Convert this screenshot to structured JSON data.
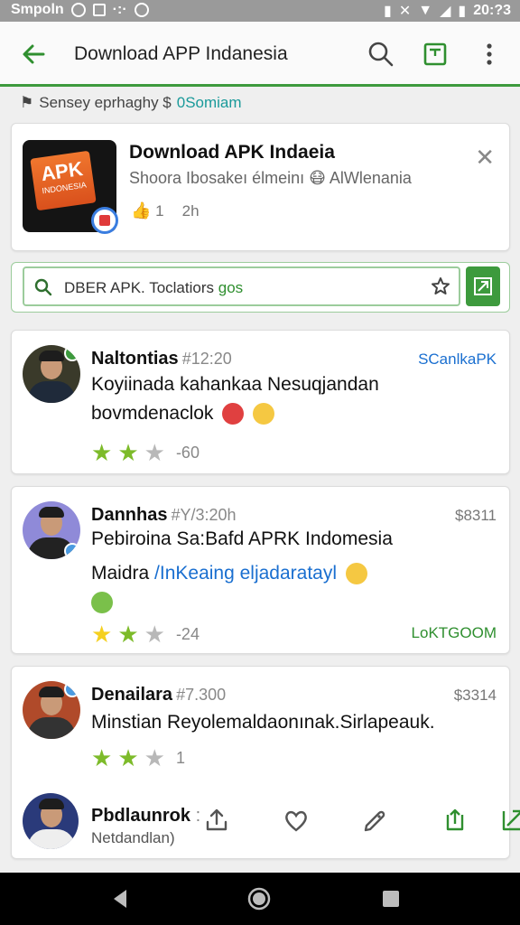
{
  "status": {
    "left_text": "Smpoln",
    "time": "20:?3"
  },
  "appbar": {
    "title": "Download APP Indanesia",
    "icons": [
      "back-arrow-icon",
      "search-icon",
      "window-icon",
      "more-vert-icon"
    ]
  },
  "subline": {
    "text": "Sensey eprhaghy $",
    "accent": "0Somiam"
  },
  "app": {
    "name": "Download APK Indaeia",
    "subtitle": "Shoora Ibosakeı élmeinı 😷 AlWlenania",
    "icon_label": "APK",
    "icon_sublabel": "INDONESIA",
    "meta": [
      "1",
      "2h"
    ]
  },
  "search": {
    "prefix": "DBER APK.",
    "text": "Toclatiors",
    "accent": "gos"
  },
  "reviews": [
    {
      "name": "Naltontias",
      "time": "#12:20",
      "tag": "SCanlkaPK",
      "tag_color": "#1a6fd0",
      "line1": "Koyiinada kahankaa Nesuqjandan",
      "line2": "bovmdenaclok",
      "count": "-60"
    },
    {
      "name": "Dannhas",
      "time": "#Y/3:20h",
      "tag": "$8311",
      "tag_color": "#777777",
      "line1": "Pebiroina Sa:Bafd APRK Indomesia",
      "line2_prefix": "Maidra ",
      "line2_link": "/InKeaing eljadaratayl",
      "count": "-24",
      "extra_tag": "LoKTGOOM",
      "extra_color": "#2f8f2f"
    },
    {
      "name": "Denailara",
      "time": "#7.300",
      "tag": "$3314",
      "tag_color": "#777777",
      "line1": "Minstian Reyolemaldaonınak.Sirlapeauk.",
      "count": "1"
    },
    {
      "name": "Pbdlaunrok",
      "time": ":",
      "sub": "Netdandlan)"
    }
  ],
  "colors": {
    "accent_green": "#3d9a3d",
    "star_green": "#7dbb2a",
    "link_blue": "#1a6fd0"
  }
}
